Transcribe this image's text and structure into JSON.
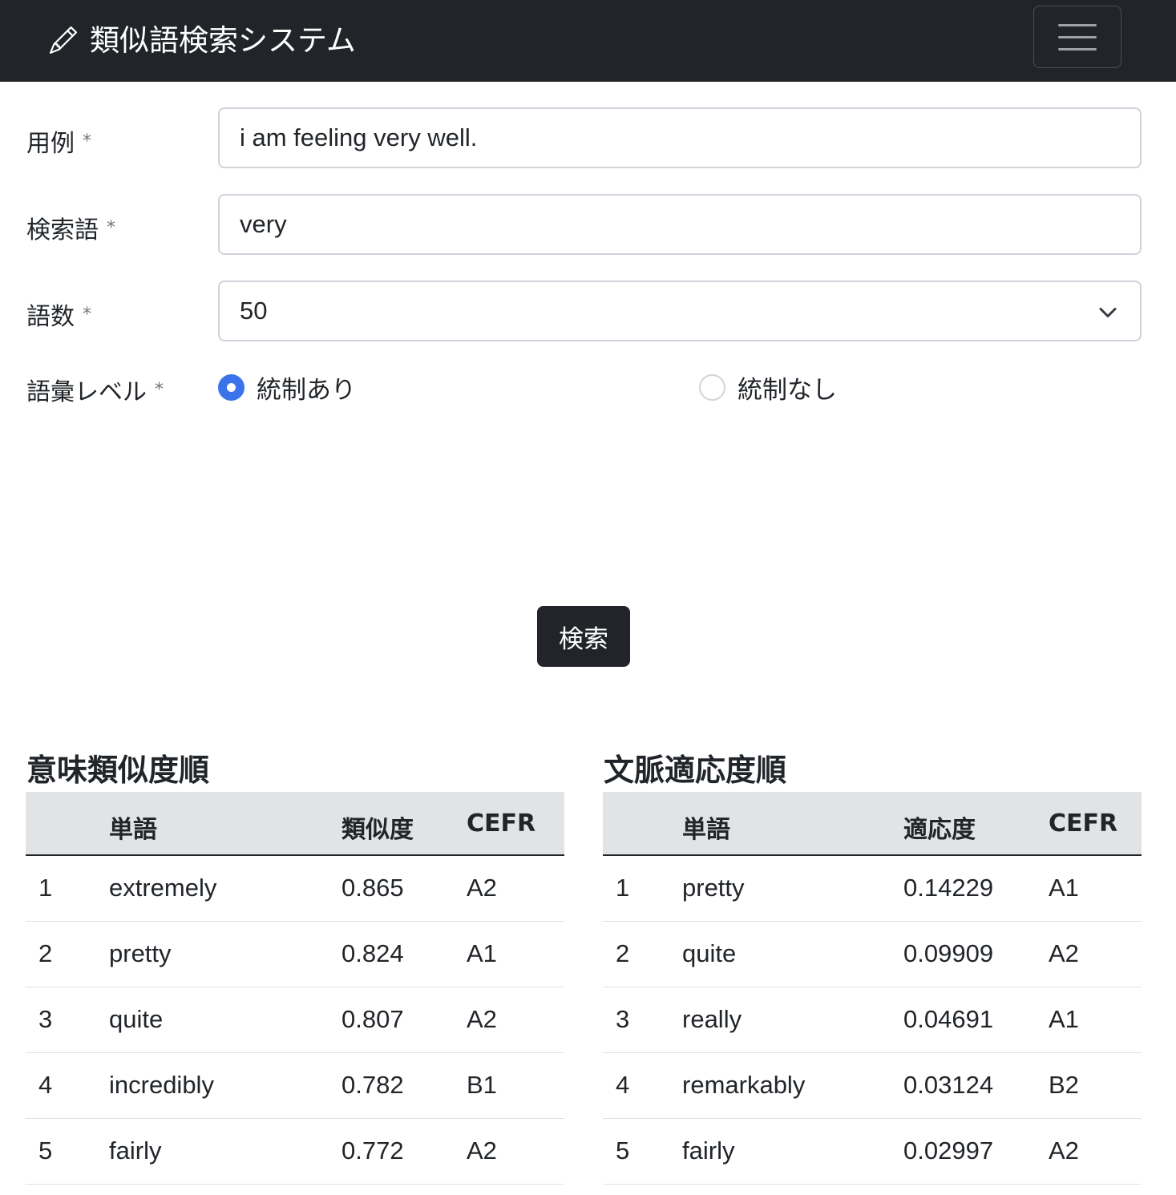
{
  "navbar": {
    "brand": "類似語検索システム",
    "brand_icon": "pencil-icon",
    "toggler_icon": "hamburger-menu-icon"
  },
  "form": {
    "example": {
      "label": "用例",
      "required_mark": "*",
      "value": "i am feeling very well."
    },
    "query": {
      "label": "検索語",
      "required_mark": "*",
      "value": "very"
    },
    "count": {
      "label": "語数",
      "required_mark": "*",
      "value": "50"
    },
    "level": {
      "label": "語彙レベル",
      "required_mark": "*",
      "options": [
        {
          "label": "統制あり",
          "checked": true
        },
        {
          "label": "統制なし",
          "checked": false
        }
      ]
    },
    "submit_label": "検索"
  },
  "similarity_table": {
    "title": "意味類似度順",
    "headers": [
      "",
      "単語",
      "類似度",
      "CEFR"
    ],
    "rows": [
      [
        "1",
        "extremely",
        "0.865",
        "A2"
      ],
      [
        "2",
        "pretty",
        "0.824",
        "A1"
      ],
      [
        "3",
        "quite",
        "0.807",
        "A2"
      ],
      [
        "4",
        "incredibly",
        "0.782",
        "B1"
      ],
      [
        "5",
        "fairly",
        "0.772",
        "A2"
      ]
    ]
  },
  "context_table": {
    "title": "文脈適応度順",
    "headers": [
      "",
      "単語",
      "適応度",
      "CEFR"
    ],
    "rows": [
      [
        "1",
        "pretty",
        "0.14229",
        "A1"
      ],
      [
        "2",
        "quite",
        "0.09909",
        "A2"
      ],
      [
        "3",
        "really",
        "0.04691",
        "A1"
      ],
      [
        "4",
        "remarkably",
        "0.03124",
        "B2"
      ],
      [
        "5",
        "fairly",
        "0.02997",
        "A2"
      ]
    ]
  },
  "colors": {
    "navbar_bg": "#212529",
    "radio_accent": "#3b74ea",
    "table_header_bg": "#e2e3e5"
  }
}
